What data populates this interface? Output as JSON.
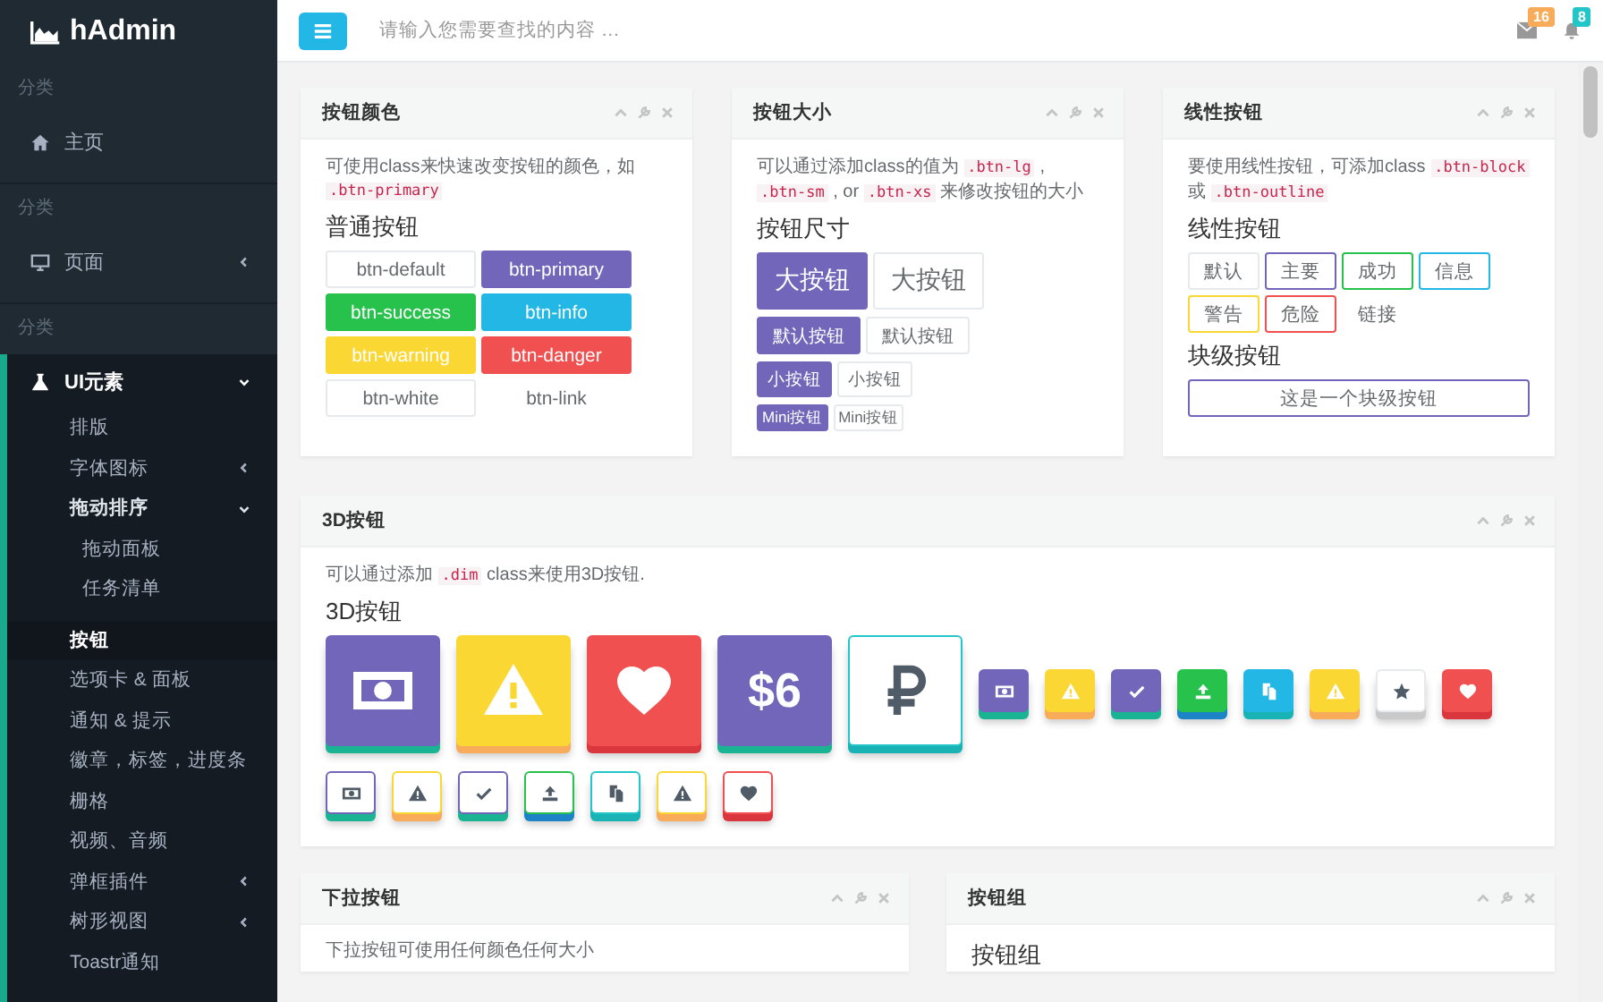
{
  "topbar": {
    "search": {
      "placeholder": "请输入您需要查找的内容 …"
    },
    "mail_badge": "16",
    "bell_badge": "8"
  },
  "sidebar": {
    "brand": "hAdmin",
    "sections": [
      {
        "label": "分类",
        "items": [
          {
            "label": "主页",
            "active": false
          }
        ]
      },
      {
        "label": "分类",
        "items": [
          {
            "label": "页面",
            "active": false,
            "expanded": false
          }
        ]
      },
      {
        "label": "分类",
        "items": [
          {
            "label": "UI元素",
            "active": true,
            "expanded": true,
            "children": [
              {
                "label": "排版",
                "selected": false
              },
              {
                "label": "字体图标",
                "selected": false,
                "expanded": false
              },
              {
                "label": "拖动排序",
                "selected": false,
                "expanded": true,
                "children": [
                  {
                    "label": "拖动面板",
                    "selected": false
                  },
                  {
                    "label": "任务清单",
                    "selected": false
                  }
                ]
              },
              {
                "label": "按钮",
                "selected": true
              },
              {
                "label": "选项卡 & 面板",
                "selected": false
              },
              {
                "label": "通知 & 提示",
                "selected": false
              },
              {
                "label": "徽章，标签，进度条",
                "selected": false
              },
              {
                "label": "栅格",
                "selected": false
              },
              {
                "label": "视频、音频",
                "selected": false
              },
              {
                "label": "弹框插件",
                "selected": false,
                "expanded": false
              },
              {
                "label": "树形视图",
                "selected": false,
                "expanded": false
              },
              {
                "label": "Toastr通知",
                "selected": false
              }
            ]
          }
        ]
      }
    ]
  },
  "button_colors": {
    "title": "按钮颜色",
    "description": [
      {
        "text": "可使用class来快速改变按钮的颜色，如",
        "code": false
      },
      {
        "text": ".btn-primary",
        "code": true
      }
    ],
    "heading": "普通按钮",
    "buttons": [
      {
        "label": "btn-default",
        "kind": "button",
        "color": "#ffffff"
      },
      {
        "label": "btn-primary",
        "kind": "button",
        "color": "#7266ba"
      },
      {
        "label": "btn-success",
        "kind": "button",
        "color": "#27c24c"
      },
      {
        "label": "btn-info",
        "kind": "button",
        "color": "#23b7e5"
      },
      {
        "label": "btn-warning",
        "kind": "button",
        "color": "#fad733"
      },
      {
        "label": "btn-danger",
        "kind": "button",
        "color": "#f05050"
      },
      {
        "label": "btn-white",
        "kind": "button",
        "color": "#ffffff"
      },
      {
        "label": "btn-link",
        "kind": "link"
      }
    ]
  },
  "button_sizes": {
    "title": "按钮大小",
    "description": [
      {
        "text": "可以通过添加class的值为",
        "code": false
      },
      {
        "text": ".btn-lg",
        "code": true
      },
      {
        "text": ",",
        "code": false
      },
      {
        "text": ".btn-sm",
        "code": true
      },
      {
        "text": ",",
        "code": false
      },
      {
        "text": "or",
        "code": false
      },
      {
        "text": ".btn-xs",
        "code": true
      },
      {
        "text": "来修改按钮的大小",
        "code": false
      }
    ],
    "heading": "按钮尺寸",
    "rows": [
      [
        {
          "label": "大按钮",
          "color": "#7266ba"
        },
        {
          "label": "大按钮",
          "color": "#ffffff"
        }
      ],
      [
        {
          "label": "默认按钮",
          "color": "#7266ba"
        },
        {
          "label": "默认按钮",
          "color": "#ffffff"
        }
      ],
      [
        {
          "label": "小按钮",
          "color": "#7266ba"
        },
        {
          "label": "小按钮",
          "color": "#ffffff"
        }
      ],
      [
        {
          "label": "Mini按钮",
          "color": "#7266ba"
        },
        {
          "label": "Mini按钮",
          "color": "#ffffff"
        }
      ]
    ]
  },
  "outline_buttons": {
    "title": "线性按钮",
    "description": [
      {
        "text": "要使用线性按钮，可添加class",
        "code": false
      },
      {
        "text": ".btn-block",
        "code": true
      },
      {
        "text": "或",
        "code": false
      },
      {
        "text": ".btn-outline",
        "code": true
      }
    ],
    "heading": "线性按钮",
    "buttons": [
      {
        "label": "默认",
        "kind": "button",
        "color": "#e7eaec"
      },
      {
        "label": "主要",
        "kind": "button",
        "color": "#7266ba"
      },
      {
        "label": "成功",
        "kind": "button",
        "color": "#27c24c"
      },
      {
        "label": "信息",
        "kind": "button",
        "color": "#23b7e5"
      },
      {
        "label": "警告",
        "kind": "button",
        "color": "#fad733"
      },
      {
        "label": "危险",
        "kind": "button",
        "color": "#f05050"
      },
      {
        "label": "链接",
        "kind": "link"
      }
    ],
    "block_heading": "块级按钮",
    "block_button": {
      "label": "这是一个块级按钮",
      "color": "#7266ba"
    }
  },
  "dim_buttons": {
    "title": "3D按钮",
    "description": [
      {
        "text": "可以通过添加",
        "code": false
      },
      {
        "text": ".dim",
        "code": true
      },
      {
        "text": "class来使用3D按钮.",
        "code": false
      }
    ],
    "heading": "3D按钮",
    "large": [
      {
        "kind": "money",
        "color": "#7266ba",
        "outline": false
      },
      {
        "kind": "warning",
        "color": "#fad733",
        "outline": false
      },
      {
        "kind": "heart",
        "color": "#f05050",
        "outline": false
      },
      {
        "kind": "text",
        "text": "$6",
        "color": "#7266ba",
        "outline": false
      },
      {
        "kind": "ruble",
        "color": "#23c6c8",
        "outline": true
      }
    ],
    "small": [
      {
        "kind": "money",
        "color": "#7266ba"
      },
      {
        "kind": "warning",
        "color": "#fad733"
      },
      {
        "kind": "check",
        "color": "#7266ba"
      },
      {
        "kind": "upload",
        "color": "#27c24c"
      },
      {
        "kind": "copy",
        "color": "#23b7e5"
      },
      {
        "kind": "warning",
        "color": "#fad733"
      },
      {
        "kind": "star",
        "color": "#ffffff"
      },
      {
        "kind": "heart",
        "color": "#f05050"
      }
    ],
    "small_outline": [
      {
        "kind": "money",
        "color": "#7266ba"
      },
      {
        "kind": "warning",
        "color": "#fad733"
      },
      {
        "kind": "check",
        "color": "#7266ba"
      },
      {
        "kind": "upload",
        "color": "#27c24c"
      },
      {
        "kind": "copy",
        "color": "#23c6c8"
      },
      {
        "kind": "warning",
        "color": "#fad733"
      },
      {
        "kind": "heart",
        "color": "#f05050"
      }
    ]
  },
  "dropdown_buttons": {
    "title": "下拉按钮",
    "description": "下拉按钮可使用任何颜色任何大小"
  },
  "button_groups": {
    "title": "按钮组",
    "heading": "按钮组"
  }
}
